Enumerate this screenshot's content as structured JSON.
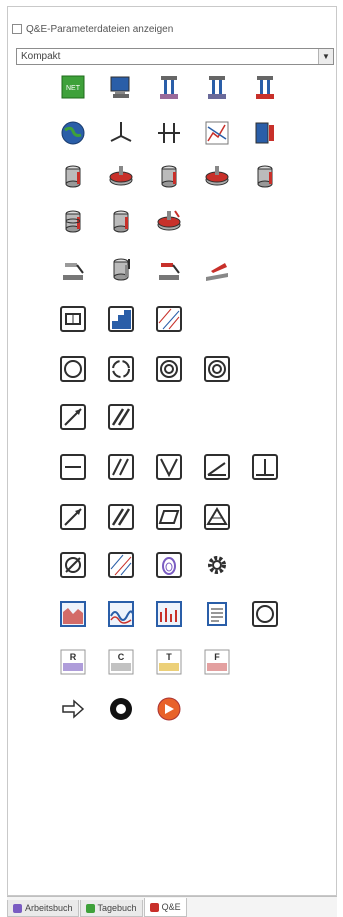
{
  "options": {
    "show_param_files_label": "Q&E-Parameterdateien anzeigen",
    "show_param_files_checked": false
  },
  "view_select": {
    "value": "Kompakt"
  },
  "icon_rows": [
    [
      "network-node-green-icon",
      "monitor-computer-icon",
      "press-machine-icon",
      "press-machine-2-icon",
      "press-machine-red-icon"
    ],
    [
      "globe-icon",
      "probe-stand-icon",
      "gauge-connector-icon",
      "xy-graph-icon",
      "cylinder-measure-icon"
    ],
    [
      "cylinder-red-icon",
      "disc-red-icon",
      "cylinder-red-2-icon",
      "disc-red-2-icon",
      "cylinder-red-3-icon"
    ],
    [
      "cylinder-stack-icon",
      "cylinder-small-icon",
      "disc-tool-icon"
    ],
    [
      "probe-tip-icon",
      "cylinder-probe-icon",
      "probe-tool-icon",
      "blade-tool-icon"
    ],
    [
      "frame-box-icon",
      "staircase-profile-icon",
      "hatched-area-icon"
    ],
    [
      "circle-icon",
      "circle-notched-icon",
      "double-circle-icon",
      "double-circle-2-icon"
    ],
    [
      "slash-arrow-icon",
      "double-slash-icon"
    ],
    [
      "straightness-icon",
      "parallelism-icon",
      "v-groove-icon",
      "angularity-icon",
      "perpendicularity-icon"
    ],
    [
      "slash-arrow-2-icon",
      "double-slash-2-icon",
      "parallelogram-icon",
      "cone-icon"
    ],
    [
      "diameter-icon",
      "hatched-area-2-icon",
      "concentric-drop-icon",
      "gear-icon"
    ],
    [
      "surface-chart-icon",
      "wave-chart-icon",
      "spectrum-chart-icon",
      "report-sheet-icon",
      "roundness-icon"
    ],
    [
      "r-chart-icon",
      "c-chart-icon",
      "t-chart-icon",
      "f-chart-icon"
    ],
    [
      "arrow-right-icon",
      "black-ring-icon",
      "orange-arrow-circle-icon"
    ]
  ],
  "colors": {
    "icon_blue": "#2a5ea8",
    "icon_red": "#c8302a",
    "icon_green": "#3ea13a",
    "icon_orange": "#e8622a",
    "icon_dark": "#2f2f2f"
  },
  "tabs": [
    {
      "label": "Arbeitsbuch",
      "active": false,
      "icon_color": "#7a5cc2"
    },
    {
      "label": "Tagebuch",
      "active": false,
      "icon_color": "#3ea13a"
    },
    {
      "label": "Q&E",
      "active": true,
      "icon_color": "#c8302a"
    }
  ]
}
